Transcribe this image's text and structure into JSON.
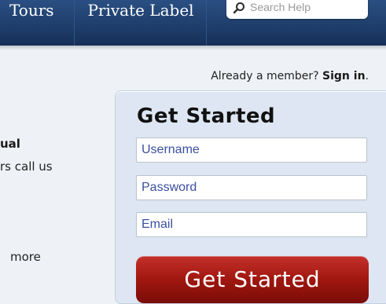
{
  "nav": {
    "items": [
      {
        "label": "Tours"
      },
      {
        "label": "Private Label"
      }
    ],
    "search": {
      "placeholder": "Search Help"
    }
  },
  "left": {
    "title": "ual",
    "text": "rs call us",
    "more": "more"
  },
  "member": {
    "prompt": "Already a member?",
    "signin": "Sign in"
  },
  "form": {
    "title": "Get Started",
    "username_placeholder": "Username",
    "password_placeholder": "Password",
    "email_placeholder": "Email",
    "submit_label": "Get Started"
  },
  "colors": {
    "nav_bg": "#1c3a66",
    "panel_bg": "#dde6f2",
    "cta_red": "#a01710"
  }
}
